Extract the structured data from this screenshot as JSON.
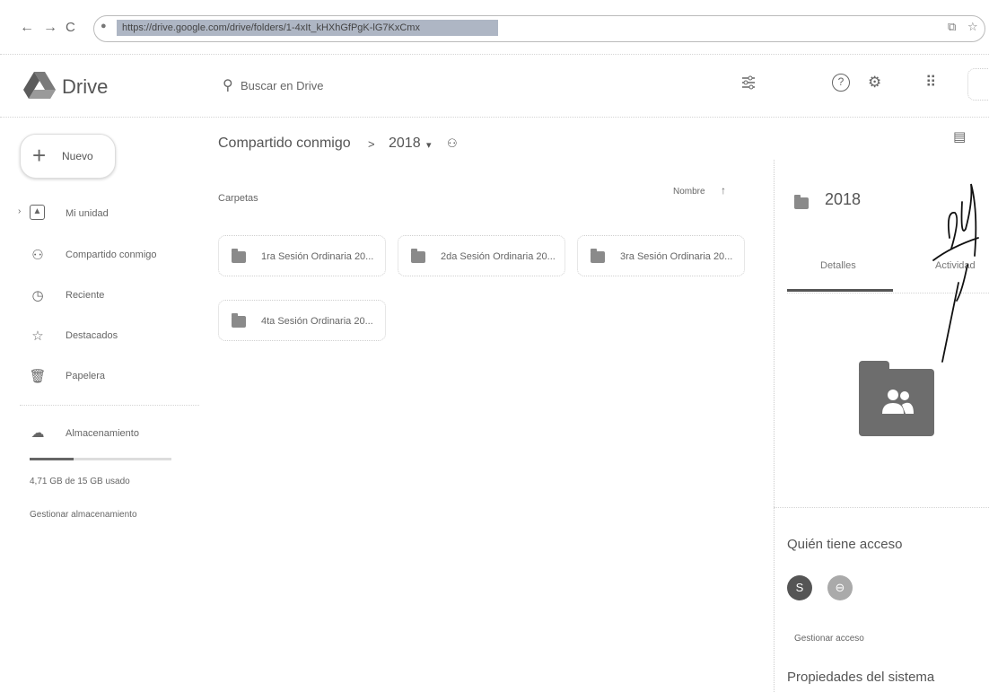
{
  "browser": {
    "back_icon": "←",
    "forward_icon": "→",
    "reload_icon": "C",
    "url": "https://drive.google.com/drive/folders/1-4xIt_kHXhGfPgK-lG7KxCmx",
    "share_icon": "⧉",
    "star_icon": "☆"
  },
  "header": {
    "logo_text": "Drive",
    "search_placeholder": "Buscar en Drive",
    "filter_icon": "tune-icon",
    "help_icon": "?",
    "settings_icon": "⚙",
    "apps_icon": "⠿"
  },
  "sidebar": {
    "new_label": "Nuevo",
    "items": [
      {
        "label": "Mi unidad",
        "icon": "drive-icon"
      },
      {
        "label": "Compartido conmigo",
        "icon": "people-icon"
      },
      {
        "label": "Reciente",
        "icon": "clock-icon"
      },
      {
        "label": "Destacados",
        "icon": "star-icon"
      },
      {
        "label": "Papelera",
        "icon": "trash-icon"
      }
    ],
    "storage_label": "Almacenamiento",
    "storage_used_text": "4,71 GB de 15 GB usado",
    "storage_fraction": 0.31,
    "manage_storage": "Gestionar almacenamiento"
  },
  "breadcrumb": {
    "root": "Compartido conmigo",
    "separator": ">",
    "current": "2018",
    "chevron": "▾"
  },
  "content": {
    "section_label": "Carpetas",
    "sort_label": "Nombre",
    "sort_arrow": "↑",
    "folders": [
      "1ra Sesión Ordinaria 20...",
      "2da Sesión Ordinaria 20...",
      "3ra Sesión Ordinaria 20...",
      "4ta Sesión Ordinaria 20..."
    ]
  },
  "details": {
    "title": "2018",
    "tabs": [
      "Detalles",
      "Actividad"
    ],
    "active_tab": 0,
    "access_title": "Quién tiene acceso",
    "avatar_letter": "S",
    "link_icon": "⊖",
    "manage_access": "Gestionar acceso",
    "properties_title": "Propiedades del sistema"
  },
  "colors": {
    "url_highlight": "#aeb6c4",
    "folder_gray": "#6d6d6d",
    "text_gray": "#555555"
  }
}
